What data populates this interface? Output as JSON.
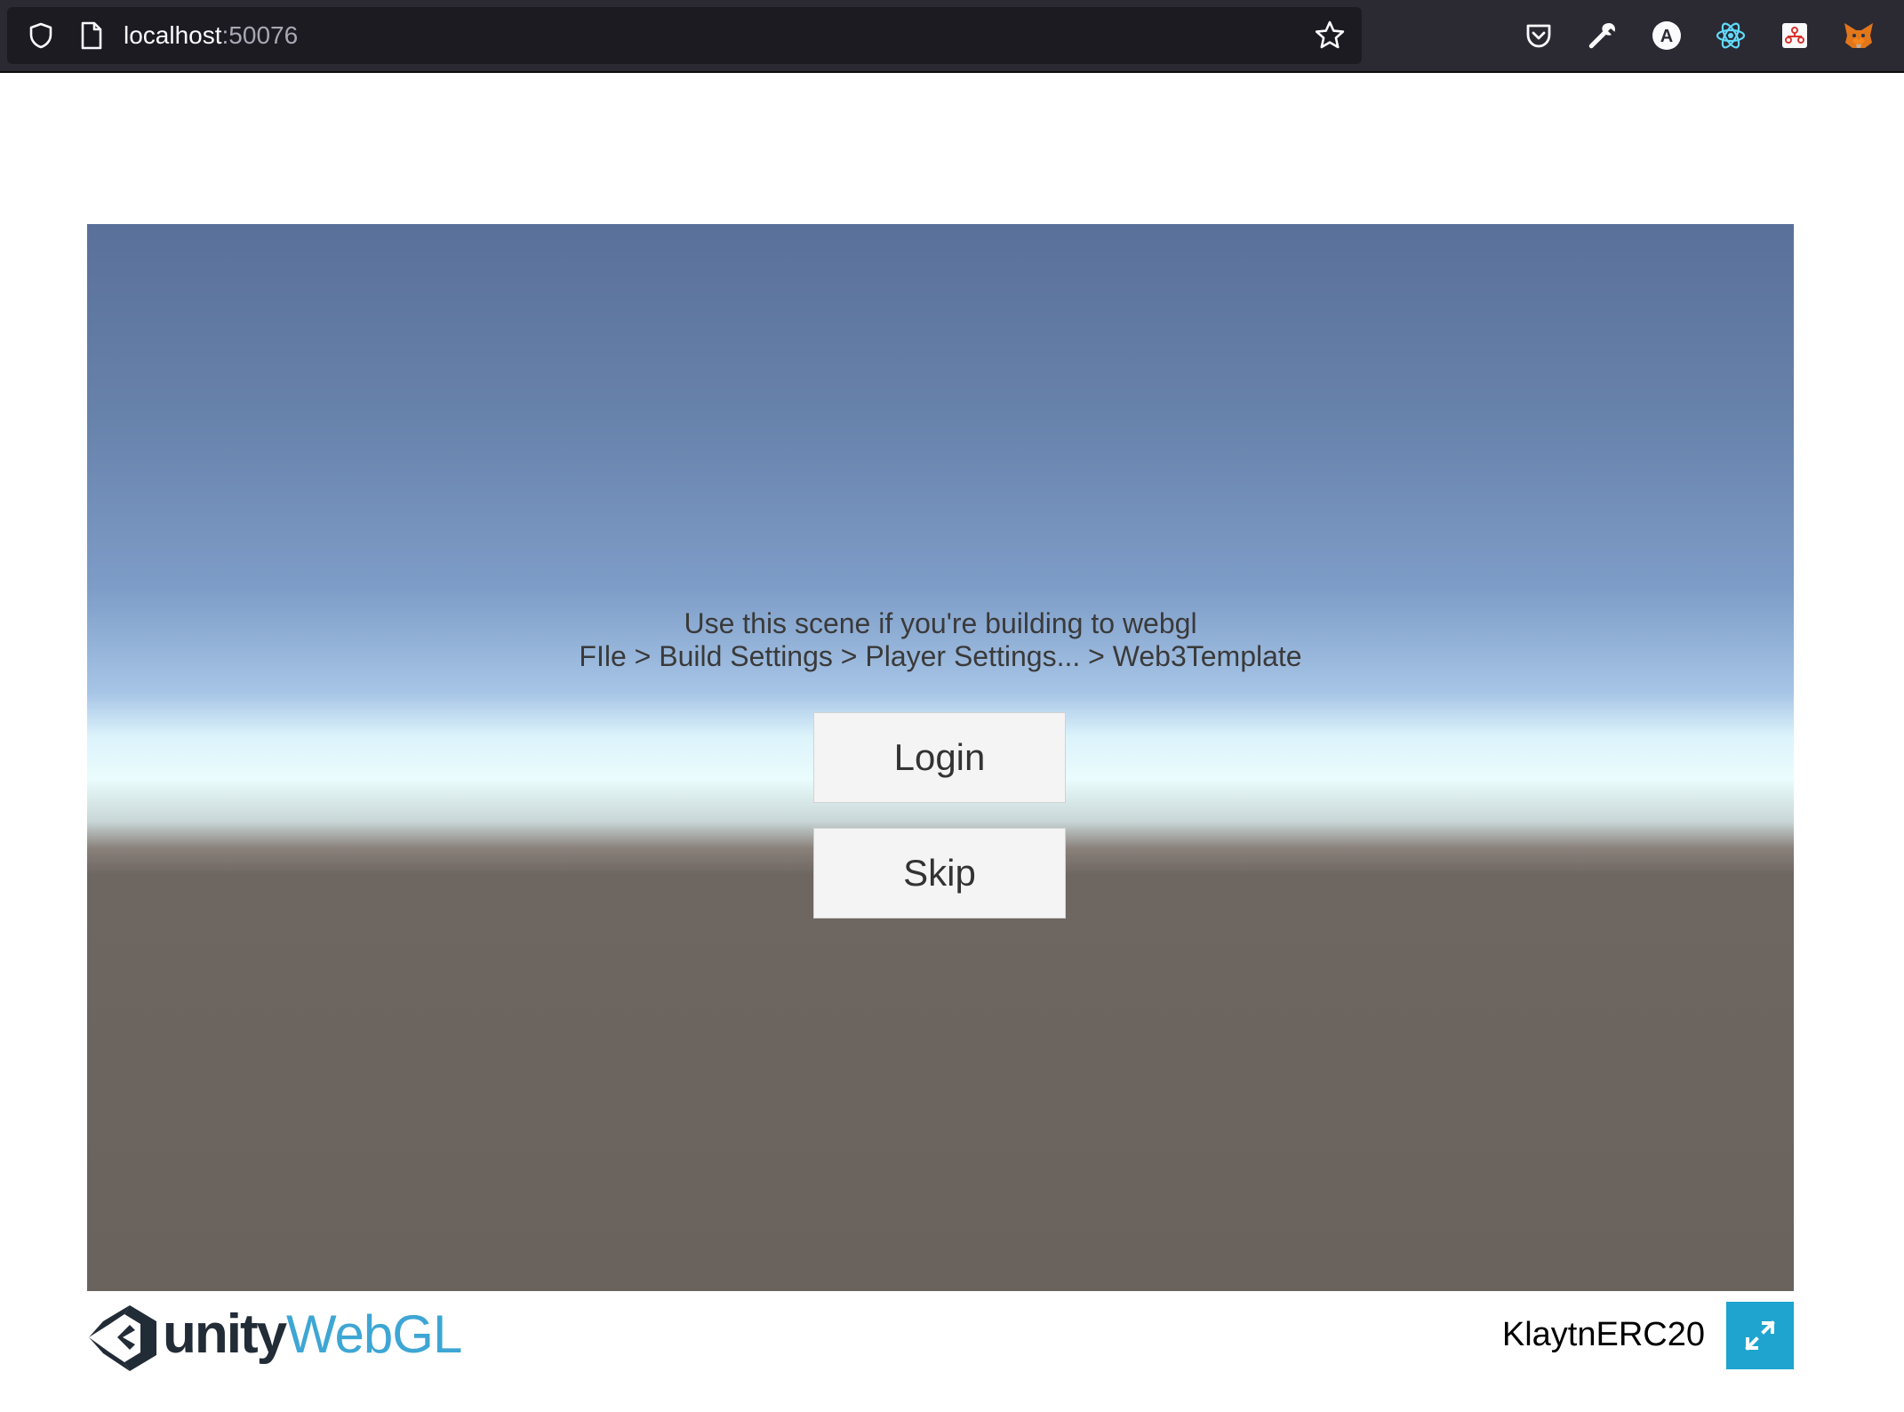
{
  "browser": {
    "url_host": "localhost",
    "url_port": ":50076",
    "extensions": [
      "pocket-icon",
      "wrench-icon",
      "a-extension-icon",
      "react-devtools-icon",
      "redux-icon",
      "metamask-fox-icon"
    ]
  },
  "scene": {
    "line1": "Use this scene if you're building to webgl",
    "line2": "FIle > Build Settings > Player Settings... > Web3Template",
    "login_label": "Login",
    "skip_label": "Skip"
  },
  "footer": {
    "logo_unity": "unity",
    "logo_webgl": "WebGL",
    "title": "KlaytnERC20"
  },
  "colors": {
    "fullscreen_button": "#1ea4cf",
    "webgl_logo": "#3ea6d4"
  }
}
